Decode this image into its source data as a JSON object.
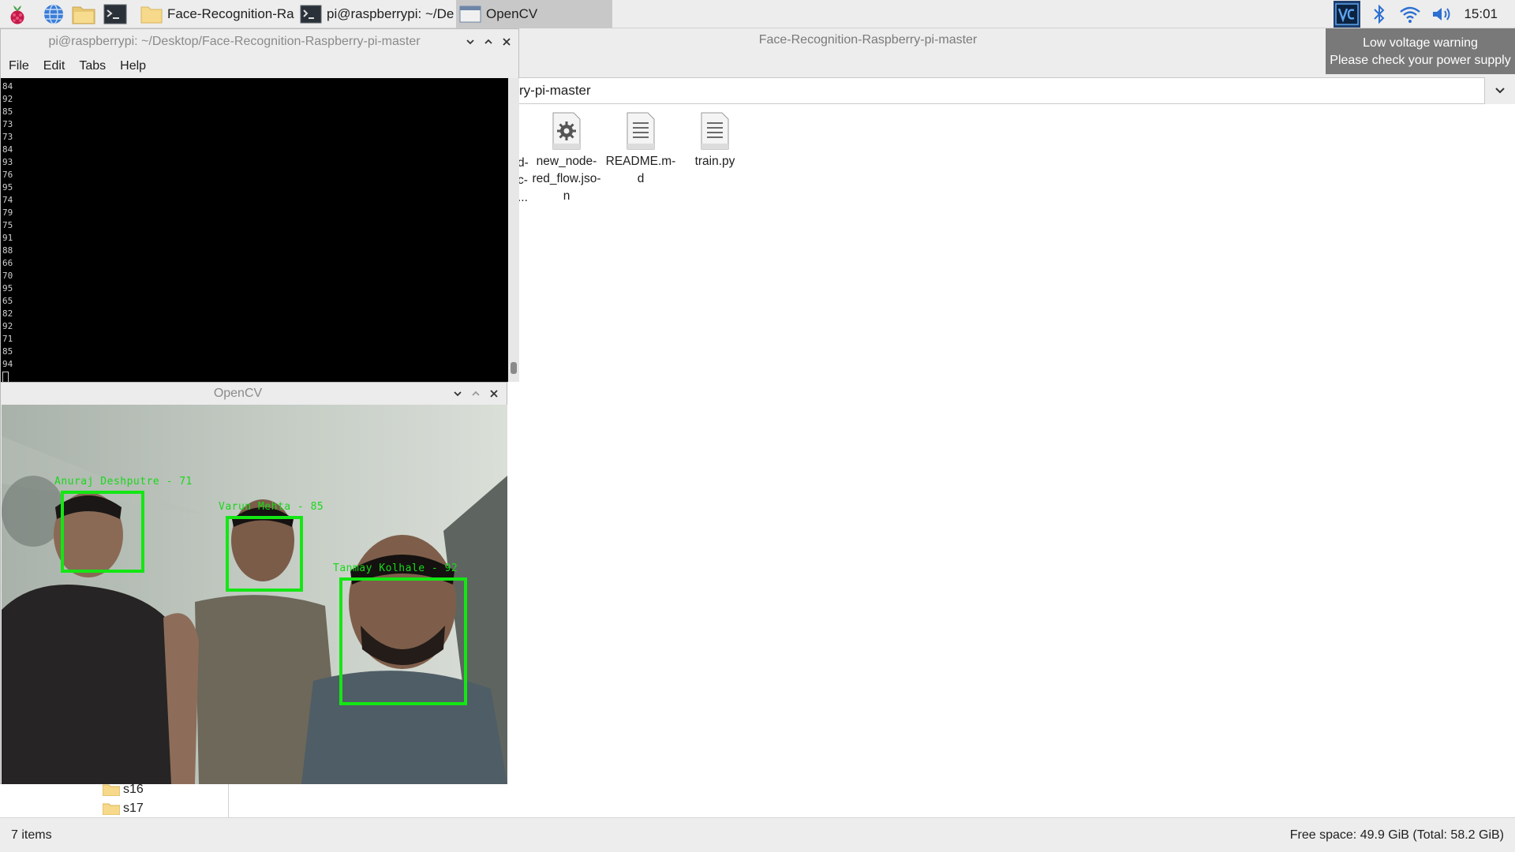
{
  "taskbar": {
    "icons": [
      "raspberry-pi-menu-icon",
      "web-browser-icon",
      "file-manager-icon",
      "terminal-icon"
    ],
    "tasks": [
      {
        "label": "Face-Recognition-Ra...",
        "icon": "folder-icon"
      },
      {
        "label": "pi@raspberrypi: ~/De...",
        "icon": "terminal-icon"
      },
      {
        "label": "OpenCV",
        "icon": "window-icon"
      }
    ],
    "tray": [
      "vnc-icon",
      "bluetooth-icon",
      "wifi-icon",
      "volume-icon"
    ],
    "clock": "15:01"
  },
  "warning": {
    "line1": "Low voltage warning",
    "line2": "Please check your power supply"
  },
  "file_manager": {
    "title": "Face-Recognition-Raspberry-pi-master",
    "path": "ry-pi-master",
    "partial_item": [
      "d-",
      "c-",
      "..."
    ],
    "files": [
      {
        "lines": [
          "new_node-",
          "red_flow.jso-",
          "n"
        ],
        "icon": "settings-file-icon"
      },
      {
        "lines": [
          "README.m-",
          "d"
        ],
        "icon": "text-file-icon"
      },
      {
        "lines": [
          "train.py"
        ],
        "icon": "text-file-icon"
      }
    ],
    "sidebar": [
      "s16",
      "s17"
    ],
    "status_left": "7 items",
    "status_right": "Free space: 49.9 GiB (Total: 58.2 GiB)"
  },
  "terminal": {
    "title": "pi@raspberrypi: ~/Desktop/Face-Recognition-Raspberry-pi-master",
    "menu": [
      "File",
      "Edit",
      "Tabs",
      "Help"
    ],
    "lines": [
      "84",
      "92",
      "85",
      "73",
      "73",
      "84",
      "93",
      "76",
      "95",
      "74",
      "79",
      "75",
      "91",
      "88",
      "66",
      "70",
      "95",
      "65",
      "82",
      "92",
      "71",
      "85",
      "94"
    ]
  },
  "opencv": {
    "title": "OpenCV",
    "faces": [
      {
        "label": "Anuraj Deshputre - 71"
      },
      {
        "label": "Varun Mehta - 85"
      },
      {
        "label": "Tanmay Kolhale - 92"
      }
    ]
  },
  "colors": {
    "taskbar_bg": "#ededed",
    "terminal_bg": "#000000",
    "face_box": "#14e614",
    "warning_bg": "#797979"
  }
}
